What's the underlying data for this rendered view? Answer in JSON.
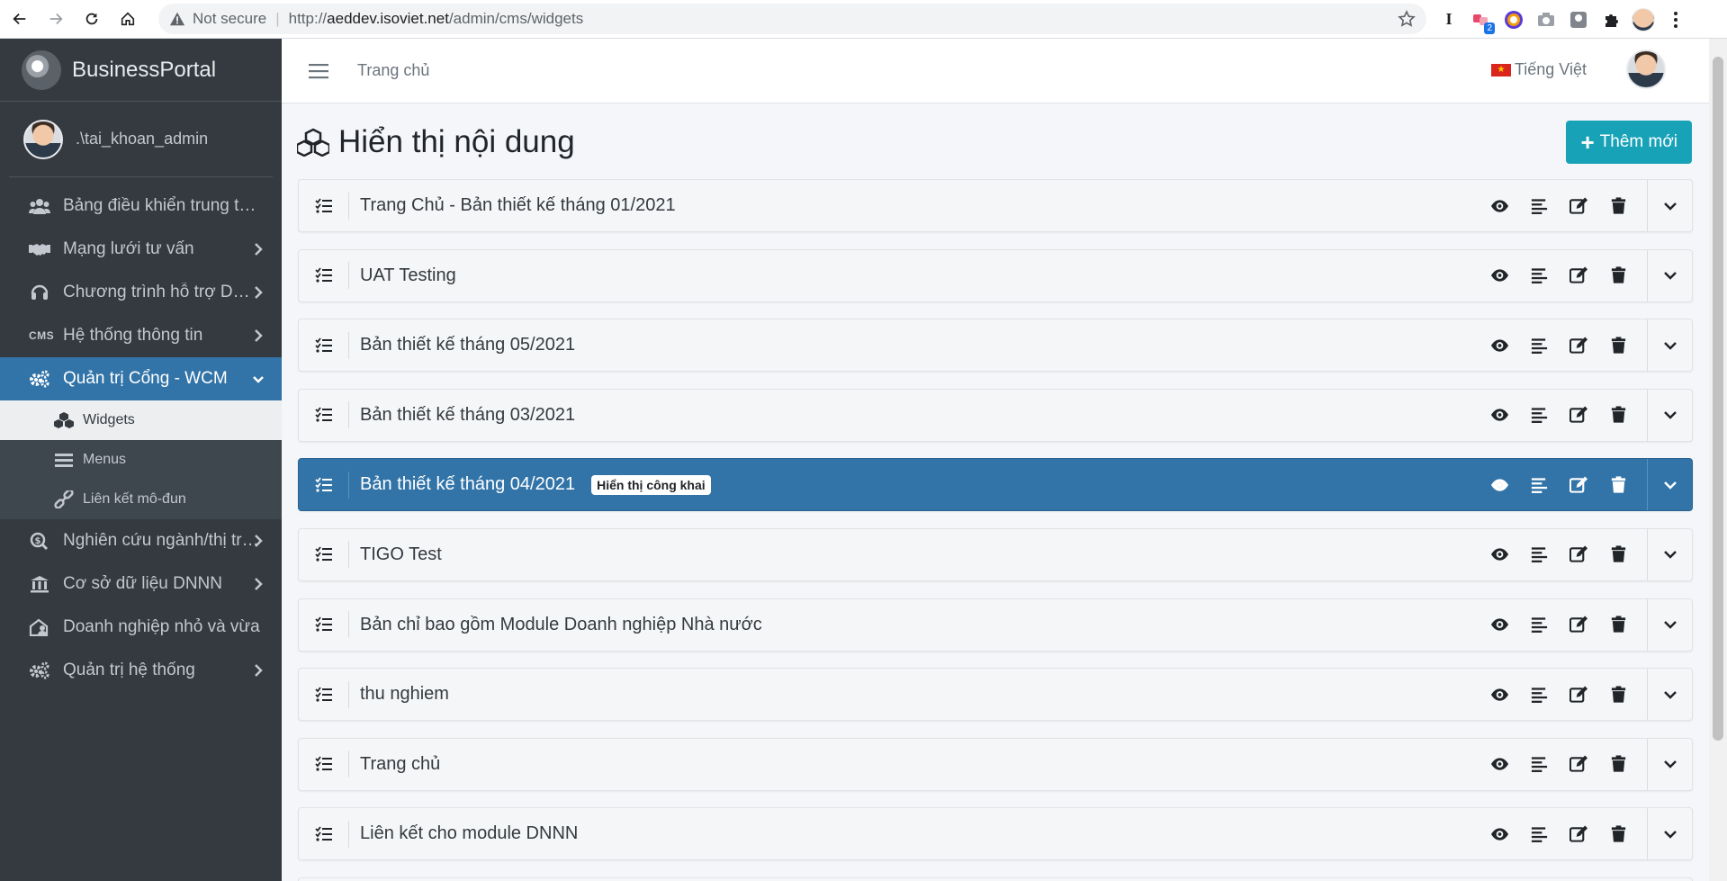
{
  "browser": {
    "security_label": "Not secure",
    "url_prefix": "http://",
    "url_host": "aeddev.isoviet.net",
    "url_path": "/admin/cms/widgets",
    "extension_badge": "2"
  },
  "sidebar": {
    "brand": "BusinessPortal",
    "user_name": ".\\tai_khoan_admin",
    "menu": [
      {
        "label": "Bảng điều khiển trung tâm",
        "icon": "users-icon"
      },
      {
        "label": "Mạng lưới tư vấn",
        "icon": "handshake-icon"
      },
      {
        "label": "Chương trình hỗ trợ DNNN",
        "icon": "headset-icon"
      },
      {
        "label": "Hệ thống thông tin",
        "icon": "cms-icon",
        "icon_text": "CMS"
      },
      {
        "label": "Quản trị Cổng - WCM",
        "icon": "cogs-icon"
      },
      {
        "label": "Nghiên cứu ngành/thị trường",
        "icon": "search-dollar-icon"
      },
      {
        "label": "Cơ sở dữ liệu DNNN",
        "icon": "bank-icon"
      },
      {
        "label": "Doanh nghiệp nhỏ và vừa",
        "icon": "house-user-icon"
      },
      {
        "label": "Quản trị hệ thống",
        "icon": "cogs-icon"
      }
    ],
    "submenu": [
      {
        "label": "Widgets",
        "icon": "cubes-icon"
      },
      {
        "label": "Menus",
        "icon": "bars-icon"
      },
      {
        "label": "Liên kết mô-đun",
        "icon": "link-icon"
      }
    ]
  },
  "topnav": {
    "home": "Trang chủ",
    "language": "Tiếng Việt"
  },
  "page": {
    "title": "Hiển thị nội dung",
    "add_button": "Thêm mới"
  },
  "widgets": [
    {
      "title": "Trang Chủ - Bản thiết kế tháng 01/2021"
    },
    {
      "title": "UAT Testing"
    },
    {
      "title": "Bản thiết kế tháng 05/2021"
    },
    {
      "title": "Bản thiết kế tháng 03/2021"
    },
    {
      "title": "Bản thiết kế tháng 04/2021",
      "badge": "Hiển thị công khai",
      "selected": true
    },
    {
      "title": "TIGO Test"
    },
    {
      "title": "Bản chỉ bao gồm Module Doanh nghiệp Nhà nước"
    },
    {
      "title": "thu nghiem"
    },
    {
      "title": "Trang chủ"
    },
    {
      "title": "Liên kết cho module DNNN"
    }
  ],
  "colors": {
    "sidebar_bg": "#343a40",
    "active_blue": "#3274a8",
    "add_button": "#17a2b8"
  }
}
